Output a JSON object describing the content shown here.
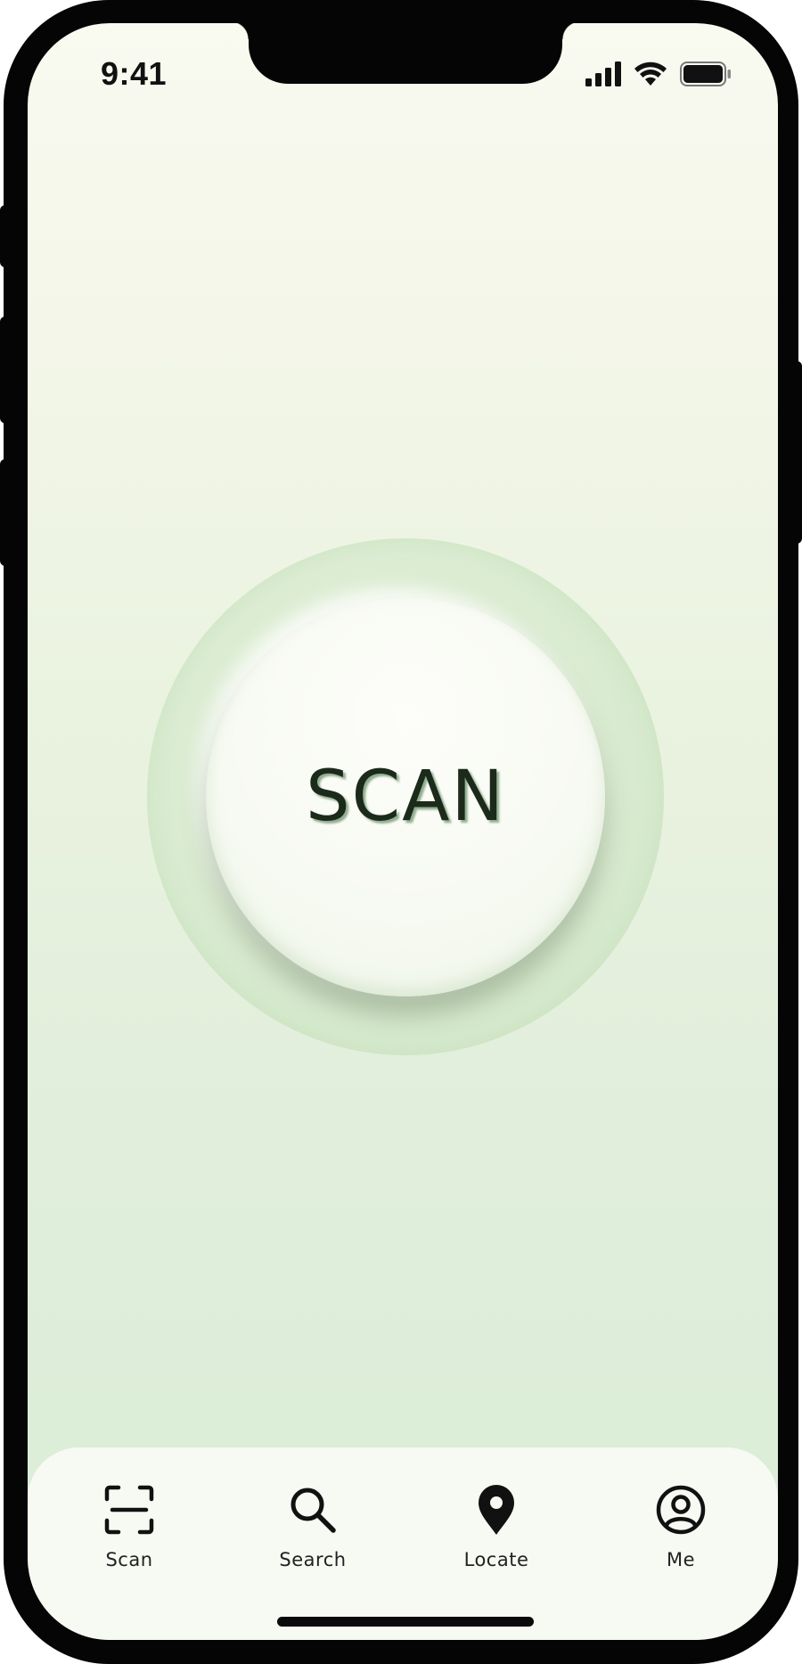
{
  "status_bar": {
    "time": "9:41",
    "icons": [
      "signal-icon",
      "wifi-icon",
      "battery-icon"
    ]
  },
  "main": {
    "scan_button_label": "SCAN"
  },
  "tabbar": {
    "items": [
      {
        "label": "Scan",
        "icon": "scan-frame-icon"
      },
      {
        "label": "Search",
        "icon": "search-icon"
      },
      {
        "label": "Locate",
        "icon": "location-pin-icon"
      },
      {
        "label": "Me",
        "icon": "user-circle-icon"
      }
    ]
  },
  "colors": {
    "background_top": "#f9faf0",
    "background_bottom": "#d9ecd6",
    "ring": "#d9ebd0",
    "button": "#f7faf2",
    "text_dark": "#1b2a1b",
    "frame": "#050505"
  }
}
